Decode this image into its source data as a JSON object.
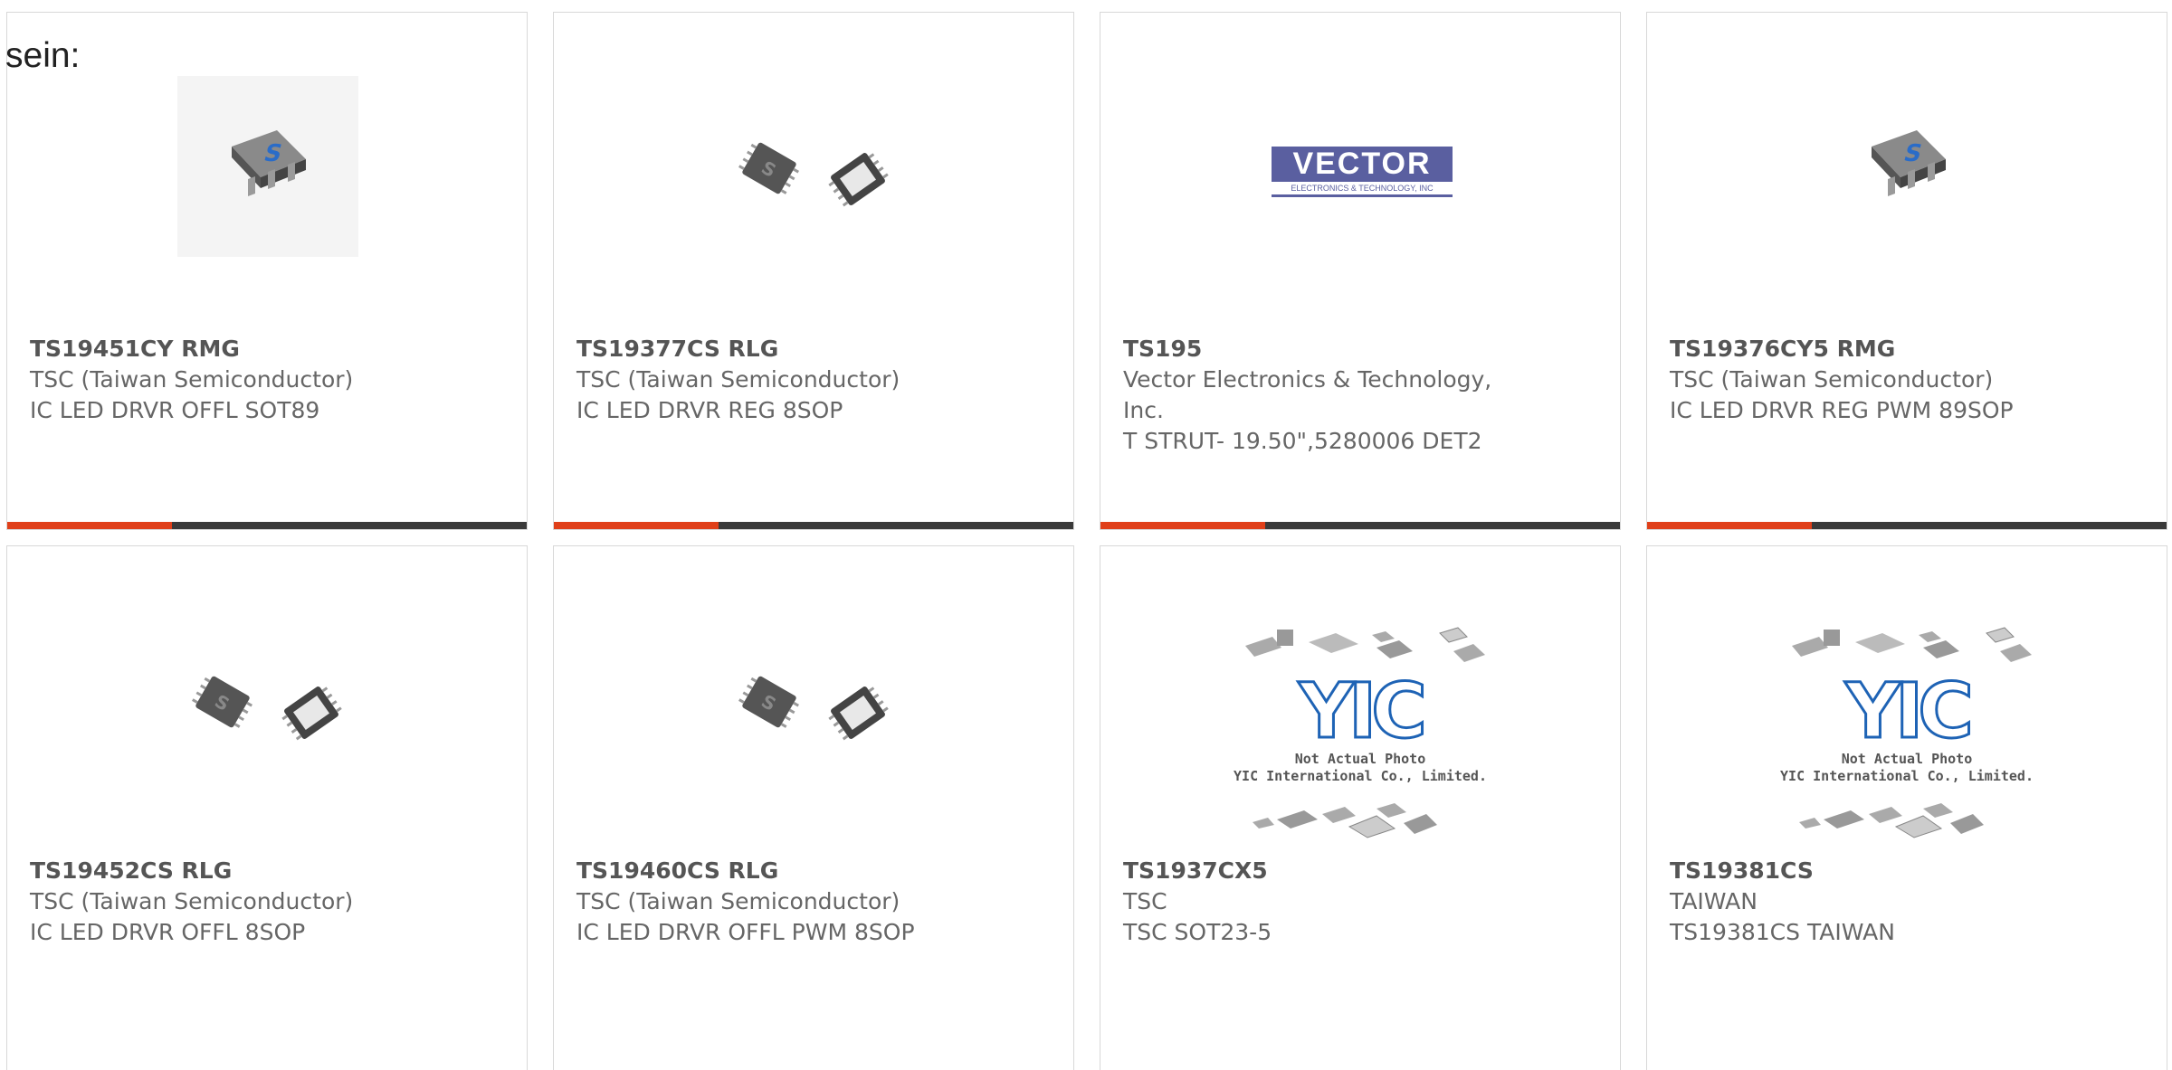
{
  "top_text": "sein:",
  "products": [
    {
      "part": "TS19451CY RMG",
      "manufacturer": "TSC (Taiwan Semiconductor)",
      "description": "IC LED DRVR OFFL SOT89",
      "image": "sot89-chip-icon"
    },
    {
      "part": "TS19377CS RLG",
      "manufacturer": "TSC (Taiwan Semiconductor)",
      "description": "IC LED DRVR REG 8SOP",
      "image": "sop8-chips-icon"
    },
    {
      "part": "TS195",
      "manufacturer": "Vector Electronics & Technology, Inc.",
      "description": "T STRUT- 19.50\",5280006 DET2",
      "image": "vector-logo"
    },
    {
      "part": "TS19376CY5 RMG",
      "manufacturer": "TSC (Taiwan Semiconductor)",
      "description": "IC LED DRVR REG PWM 89SOP",
      "image": "sot89-chip-icon"
    },
    {
      "part": "TS19452CS RLG",
      "manufacturer": "TSC (Taiwan Semiconductor)",
      "description": "IC LED DRVR OFFL 8SOP",
      "image": "sop8-chips-icon"
    },
    {
      "part": "TS19460CS RLG",
      "manufacturer": "TSC (Taiwan Semiconductor)",
      "description": "IC LED DRVR OFFL PWM 8SOP",
      "image": "sop8-chips-icon"
    },
    {
      "part": "TS1937CX5",
      "manufacturer": "TSC",
      "description": "TSC SOT23-5",
      "image": "yic-placeholder-icon"
    },
    {
      "part": "TS19381CS",
      "manufacturer": "TAIWAN",
      "description": "TS19381CS TAIWAN",
      "image": "yic-placeholder-icon"
    }
  ],
  "vector_logo": {
    "top": "VECTOR",
    "bottom": "ELECTRONICS & TECHNOLOGY, INC"
  },
  "yic_logo": {
    "mark": "YIC",
    "caption_line1": "Not Actual Photo",
    "caption_line2": "YIC International Co., Limited."
  },
  "colors": {
    "accent": "#e0401a",
    "bar": "#3a3a3a",
    "chip_logo": "#1e63b5"
  }
}
